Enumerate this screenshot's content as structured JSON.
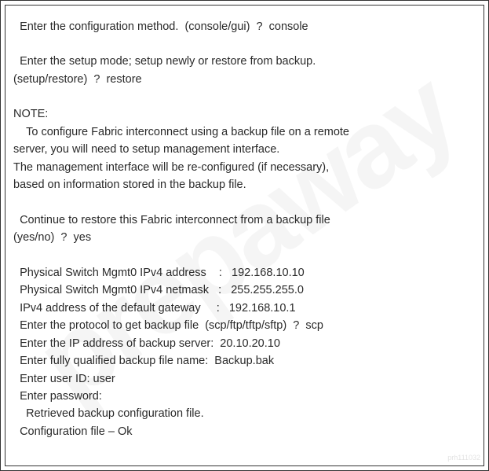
{
  "watermark": "prepaway",
  "footer_watermark": "prh111032",
  "lines": {
    "l1": "  Enter the configuration method.  (console/gui)  ?  console",
    "l2": "  Enter the setup mode; setup newly or restore from backup.",
    "l3": "(setup/restore)  ?  restore",
    "l4": "NOTE:",
    "l5": "    To configure Fabric interconnect using a backup file on a remote",
    "l6": "server, you will need to setup management interface.",
    "l7": "The management interface will be re-configured (if necessary),",
    "l8": "based on information stored in the backup file.",
    "l9": "  Continue to restore this Fabric interconnect from a backup file",
    "l10": "(yes/no)  ?  yes",
    "l11": "  Physical Switch Mgmt0 IPv4 address    :   192.168.10.10",
    "l12": "  Physical Switch Mgmt0 IPv4 netmask   :   255.255.255.0",
    "l13": "  IPv4 address of the default gateway     :   192.168.10.1",
    "l14": "  Enter the protocol to get backup file  (scp/ftp/tftp/sftp)  ?  scp",
    "l15": "  Enter the IP address of backup server:  20.10.20.10",
    "l16": "  Enter fully qualified backup file name:  Backup.bak",
    "l17": "  Enter user ID: user",
    "l18": "  Enter password:",
    "l19": "    Retrieved backup configuration file.",
    "l20": "  Configuration file – Ok"
  }
}
